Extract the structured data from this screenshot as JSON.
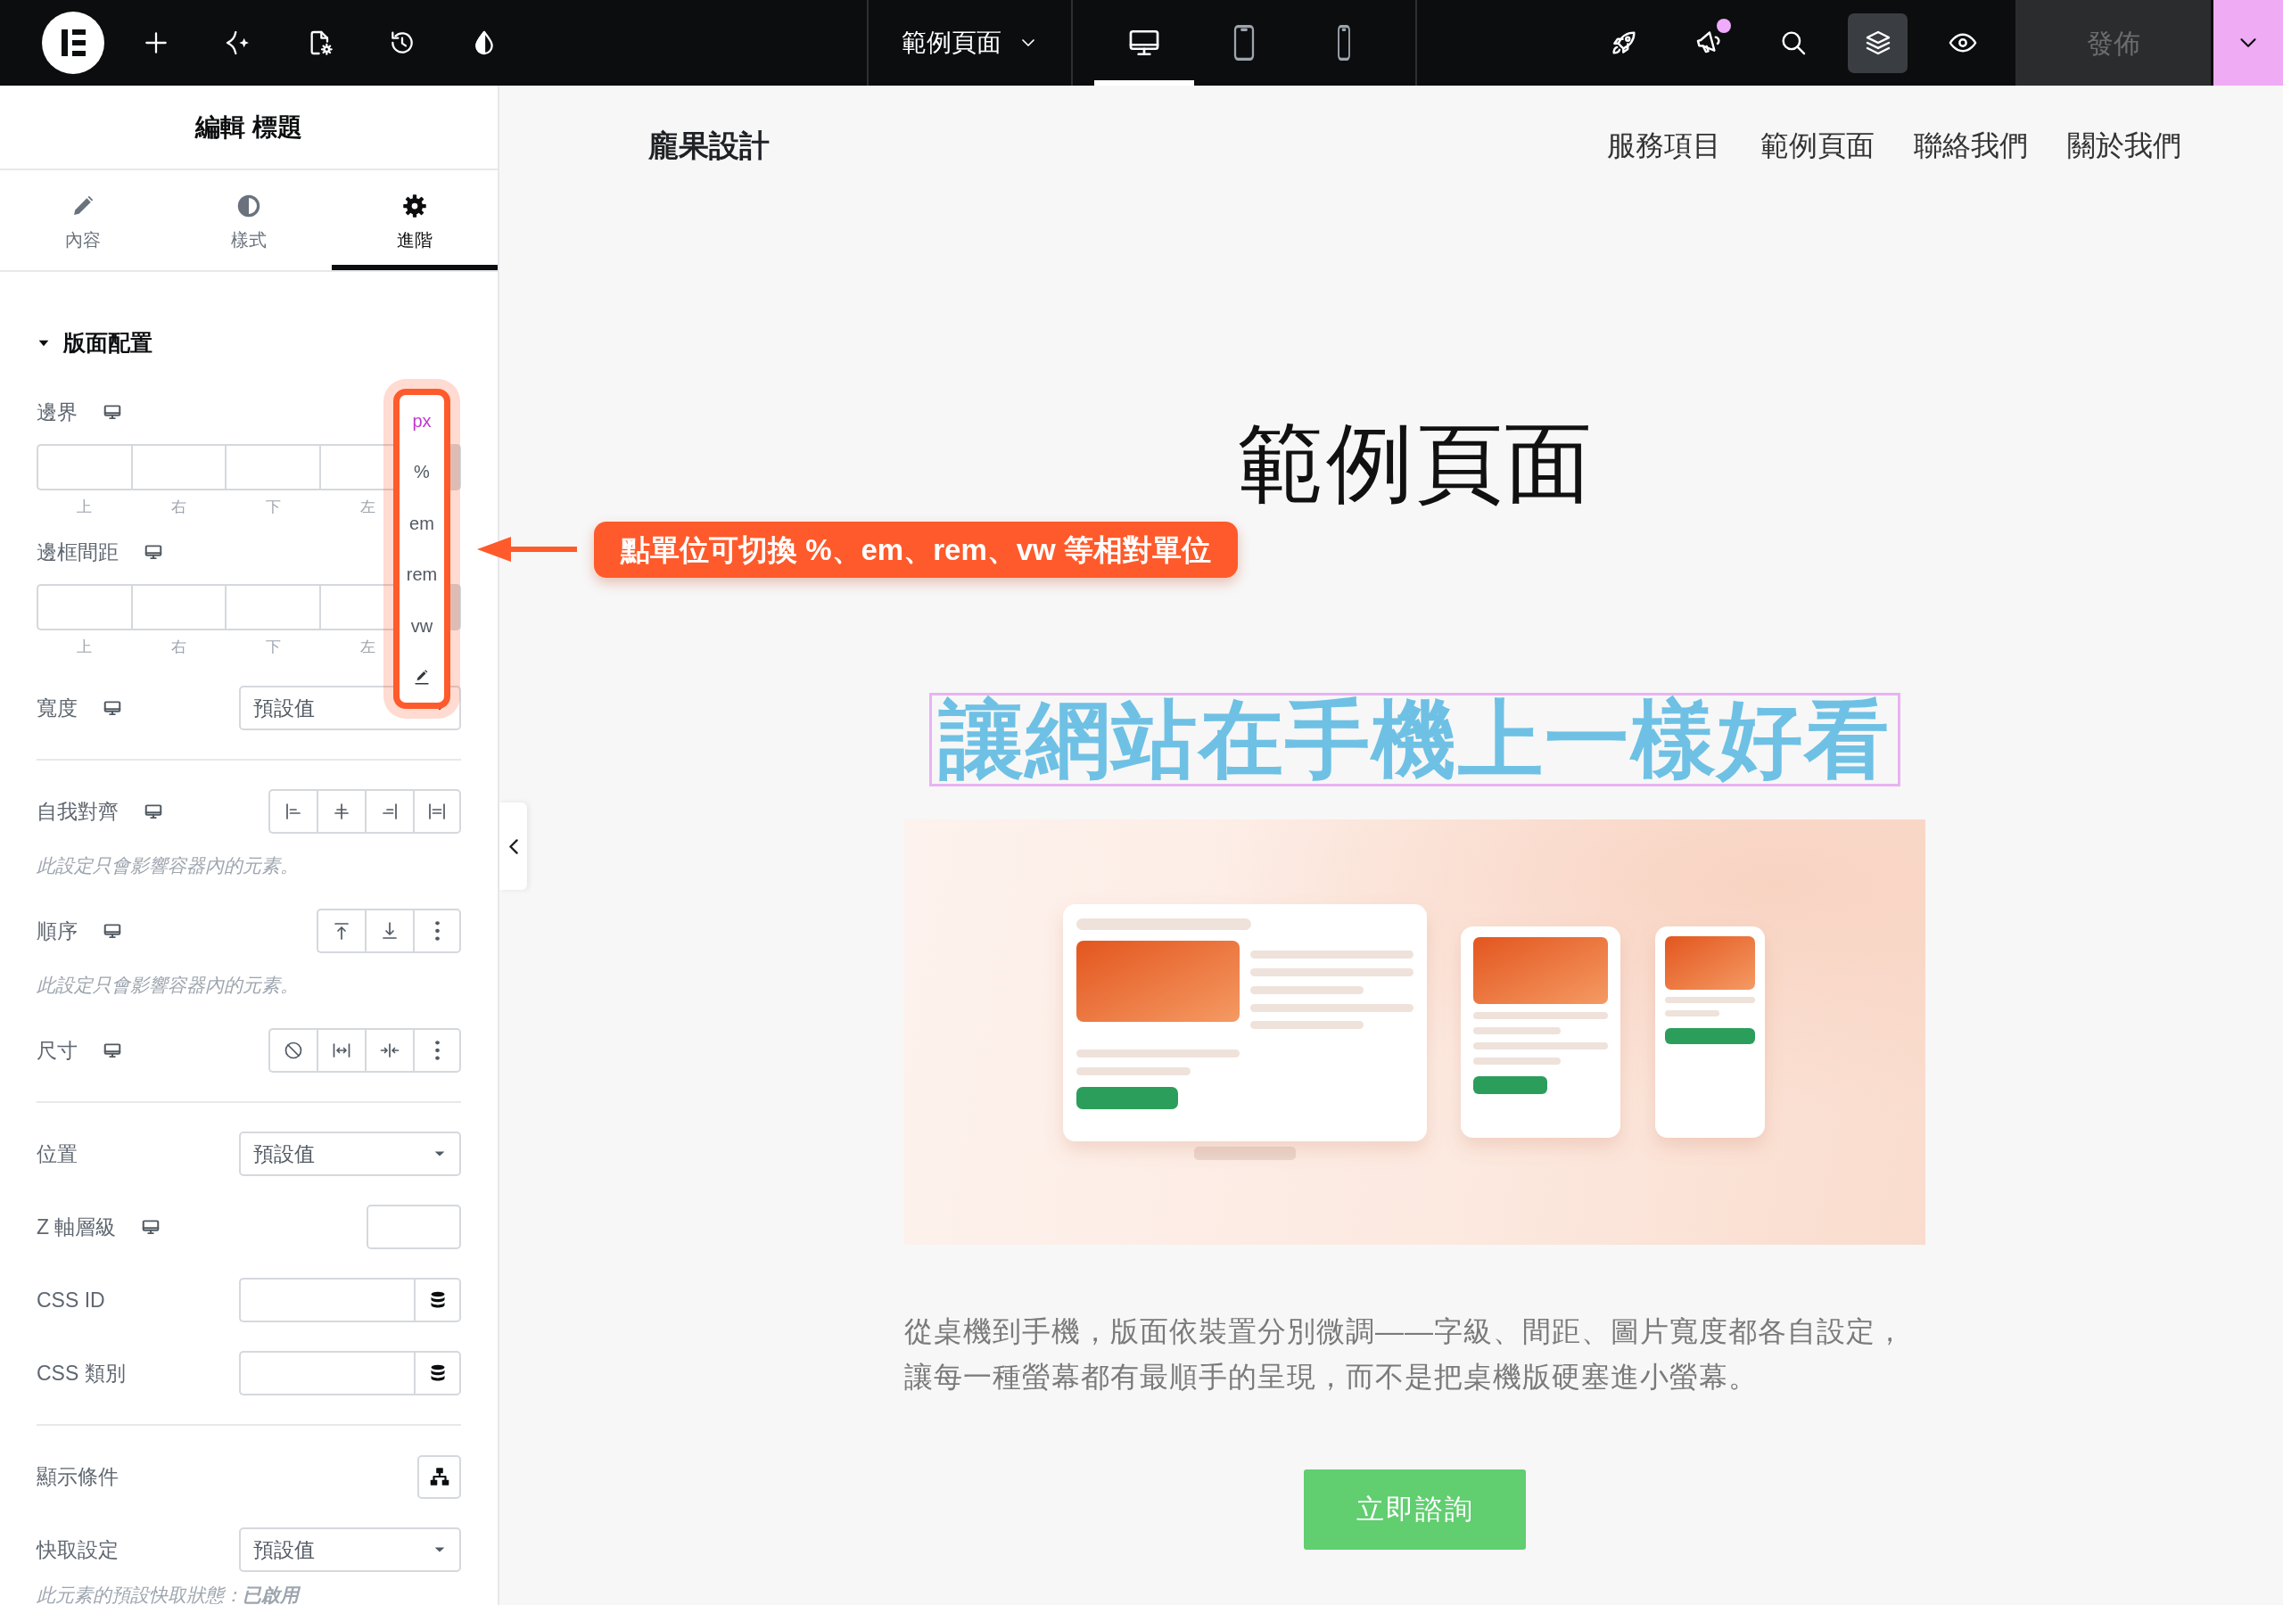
{
  "top_bar": {
    "left_tools": [
      {
        "kind": "add"
      },
      {
        "kind": "ai"
      },
      {
        "kind": "page_settings"
      },
      {
        "kind": "history"
      },
      {
        "kind": "theme"
      }
    ],
    "page_menu": {
      "label": "範例頁面"
    },
    "devices": [
      {
        "kind": "desktop",
        "selected": true
      },
      {
        "kind": "tablet",
        "selected": false
      },
      {
        "kind": "mobile",
        "selected": false
      }
    ],
    "right_tools": [
      {
        "kind": "launch",
        "active": false,
        "notification": false
      },
      {
        "kind": "announcements",
        "active": false,
        "notification": true
      },
      {
        "kind": "search",
        "active": false,
        "notification": false
      },
      {
        "kind": "structure",
        "active": true,
        "notification": false
      },
      {
        "kind": "preview",
        "active": false,
        "notification": false
      }
    ],
    "publish": {
      "label": "發佈",
      "disabled": true
    }
  },
  "panel": {
    "title": "編輯 標題",
    "tabs": [
      {
        "kind": "content",
        "label": "內容",
        "selected": false
      },
      {
        "kind": "style",
        "label": "樣式",
        "selected": false
      },
      {
        "kind": "advanced",
        "label": "進階",
        "selected": true
      }
    ],
    "section": {
      "title": "版面配置",
      "expanded": true
    },
    "controls": [
      {
        "kind": "dimensions",
        "label": "邊界",
        "responsive": true,
        "sides": [
          "上",
          "右",
          "下",
          "左"
        ]
      },
      {
        "kind": "dimensions",
        "label": "邊框間距",
        "responsive": true,
        "sides": [
          "上",
          "右",
          "下",
          "左"
        ]
      },
      {
        "kind": "select",
        "label": "寬度",
        "responsive": true,
        "value": "預設值"
      },
      {
        "kind": "divider"
      },
      {
        "kind": "align_self",
        "label": "自我對齊",
        "responsive": true
      },
      {
        "kind": "note",
        "text": "此設定只會影響容器內的元素。"
      },
      {
        "kind": "order",
        "label": "順序",
        "responsive": true
      },
      {
        "kind": "note",
        "text": "此設定只會影響容器內的元素。"
      },
      {
        "kind": "size",
        "label": "尺寸",
        "responsive": true
      },
      {
        "kind": "divider"
      },
      {
        "kind": "select",
        "label": "位置",
        "responsive": false,
        "value": "預設值"
      },
      {
        "kind": "number",
        "label": "Z 軸層級",
        "responsive": true
      },
      {
        "kind": "dynamic_text",
        "label": "CSS ID",
        "responsive": false
      },
      {
        "kind": "dynamic_text",
        "label": "CSS 類別",
        "responsive": false
      },
      {
        "kind": "divider"
      },
      {
        "kind": "conditions",
        "label": "顯示條件",
        "responsive": false
      },
      {
        "kind": "select",
        "label": "快取設定",
        "responsive": false,
        "value": "預設值"
      },
      {
        "kind": "note",
        "text": "此元素的預設快取狀態：**已啟用**"
      }
    ]
  },
  "unit_menu": {
    "units": [
      {
        "label": "px",
        "selected": true
      },
      {
        "label": "%",
        "selected": false
      },
      {
        "label": "em",
        "selected": false
      },
      {
        "label": "rem",
        "selected": false
      },
      {
        "label": "vw",
        "selected": false
      }
    ]
  },
  "callout": {
    "text": "點單位可切換 %、em、rem、vw 等相對單位"
  },
  "canvas": {
    "brand": "龐果設計",
    "nav": [
      "服務項目",
      "範例頁面",
      "聯絡我們",
      "關於我們"
    ],
    "page_title": "範例頁面",
    "heading": {
      "text": "讓網站在手機上一樣好看",
      "selected": true
    },
    "paragraph_lines": [
      "從桌機到手機，版面依裝置分別微調——字級、間距、圖片寬度都各自設定，",
      "讓每一種螢幕都有最順手的呈現，而不是把桌機版硬塞進小螢幕。"
    ],
    "cta": {
      "label": "立即諮詢"
    }
  }
}
